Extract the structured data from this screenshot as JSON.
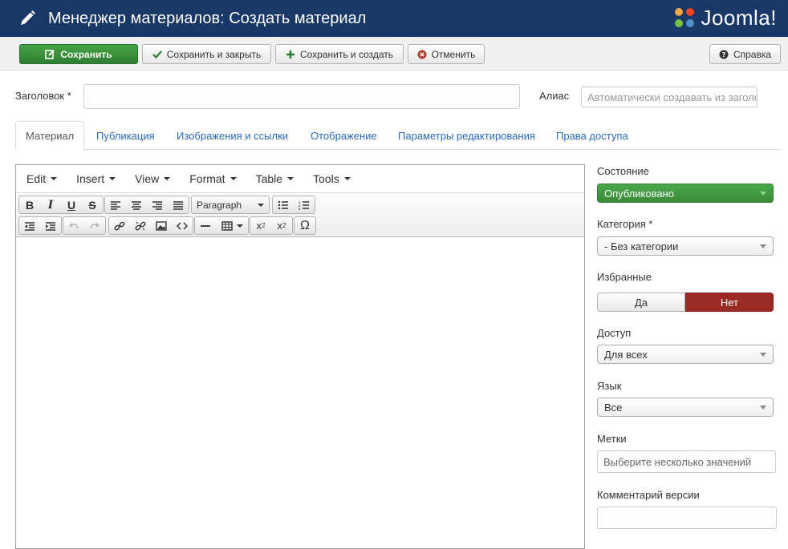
{
  "header": {
    "title": "Менеджер материалов: Создать материал",
    "logo_text": "Joomla!"
  },
  "toolbar": {
    "save": "Сохранить",
    "save_close": "Сохранить и закрыть",
    "save_new": "Сохранить и создать",
    "cancel": "Отменить",
    "help": "Справка"
  },
  "form": {
    "title_label": "Заголовок *",
    "title_value": "",
    "alias_label": "Алиас",
    "alias_placeholder": "Автоматически создавать из заголовка"
  },
  "tabs": [
    "Материал",
    "Публикация",
    "Изображения и ссылки",
    "Отображение",
    "Параметры редактирования",
    "Права доступа"
  ],
  "editor": {
    "menus": [
      "Edit",
      "Insert",
      "View",
      "Format",
      "Table",
      "Tools"
    ],
    "format_select": "Paragraph"
  },
  "sidebar": {
    "state_label": "Состояние",
    "state_value": "Опубликовано",
    "category_label": "Категория *",
    "category_value": "- Без категории",
    "featured_label": "Избранные",
    "featured_yes": "Да",
    "featured_no": "Нет",
    "featured_value": "Нет",
    "access_label": "Доступ",
    "access_value": "Для всех",
    "language_label": "Язык",
    "language_value": "Все",
    "tags_label": "Метки",
    "tags_placeholder": "Выберите несколько значений",
    "version_note_label": "Комментарий версии",
    "version_note_value": ""
  },
  "colors": {
    "header_bg": "#1a3867",
    "save_green": "#3a8b3a",
    "featured_no_red": "#9c2a24",
    "link_blue": "#2a69b8"
  }
}
